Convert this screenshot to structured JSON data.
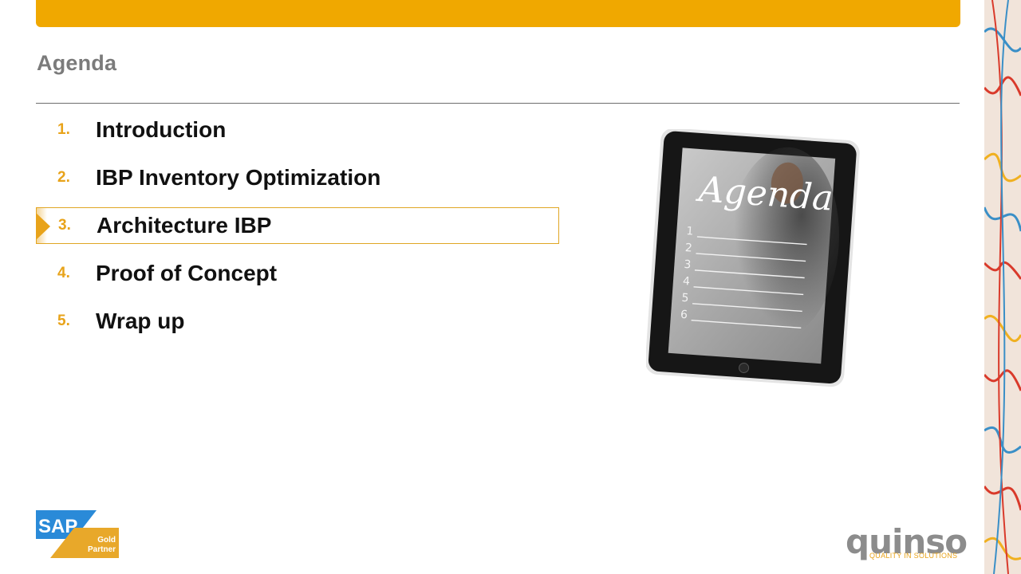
{
  "header": {
    "title": "Agenda",
    "accent_color": "#f0a800"
  },
  "agenda": {
    "items": [
      {
        "number": "1.",
        "label": "Introduction",
        "active": false
      },
      {
        "number": "2.",
        "label": "IBP Inventory Optimization",
        "active": false
      },
      {
        "number": "3.",
        "label": "Architecture IBP",
        "active": true
      },
      {
        "number": "4.",
        "label": "Proof of Concept",
        "active": false
      },
      {
        "number": "5.",
        "label": "Wrap up",
        "active": false
      }
    ]
  },
  "illustration": {
    "tablet_heading": "Agenda",
    "tablet_lines": [
      "1",
      "2",
      "3",
      "4",
      "5",
      "6"
    ]
  },
  "logos": {
    "sap": {
      "brand": "SAP",
      "line1": "Gold",
      "line2": "Partner"
    },
    "quinso": {
      "brand": "quinso",
      "tagline": "QUALITY IN SOLUTIONS"
    }
  }
}
